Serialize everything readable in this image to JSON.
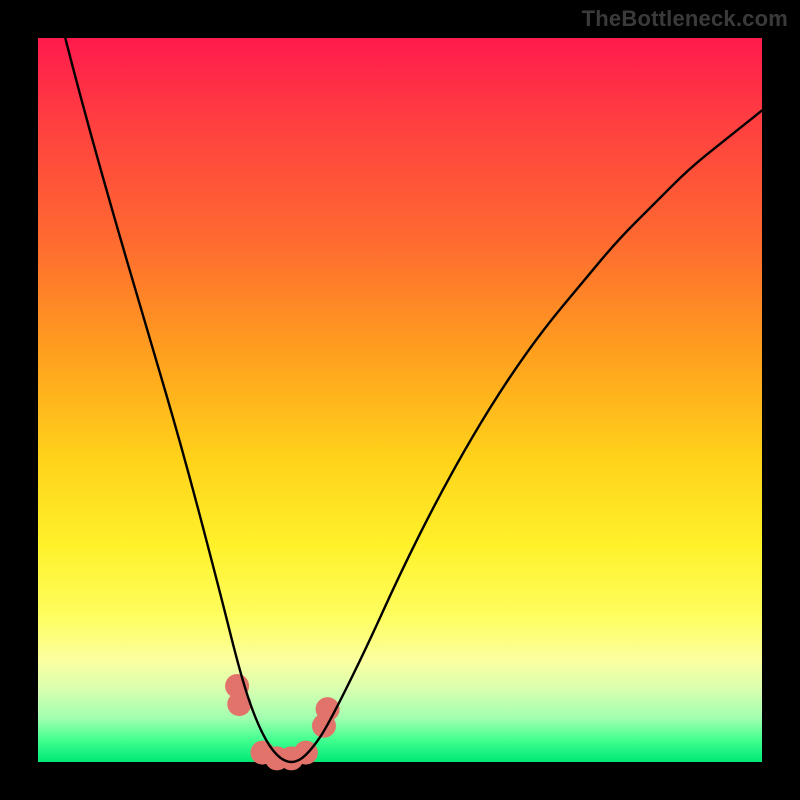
{
  "watermark": "TheBottleneck.com",
  "chart_data": {
    "type": "line",
    "title": "",
    "xlabel": "",
    "ylabel": "",
    "xlim": [
      0,
      100
    ],
    "ylim": [
      0,
      100
    ],
    "grid": false,
    "legend": false,
    "series": [
      {
        "name": "bottleneck-curve",
        "x": [
          0,
          5,
          10,
          15,
          20,
          25,
          28,
          30,
          32,
          34,
          36,
          38,
          40,
          45,
          50,
          55,
          60,
          65,
          70,
          75,
          80,
          85,
          90,
          95,
          100
        ],
        "values": [
          115,
          95,
          77,
          60,
          43,
          24,
          12,
          6,
          2,
          0,
          0,
          2,
          5,
          15,
          26,
          36,
          45,
          53,
          60,
          66,
          72,
          77,
          82,
          86,
          90
        ]
      }
    ],
    "markers": {
      "name": "highlight-dots",
      "x": [
        27.5,
        27.8,
        31,
        33,
        35,
        37,
        39.5,
        40.0
      ],
      "values": [
        10.5,
        8.0,
        1.3,
        0.5,
        0.5,
        1.3,
        5.0,
        7.3
      ],
      "color": "#e2736b",
      "radius": 12
    },
    "background": {
      "type": "vertical-gradient",
      "stops": [
        {
          "pos": 0.0,
          "color": "#ff1a4d"
        },
        {
          "pos": 0.28,
          "color": "#ff6a30"
        },
        {
          "pos": 0.58,
          "color": "#ffd21a"
        },
        {
          "pos": 0.8,
          "color": "#fffe60"
        },
        {
          "pos": 0.94,
          "color": "#a0ffb0"
        },
        {
          "pos": 1.0,
          "color": "#00e874"
        }
      ]
    }
  }
}
